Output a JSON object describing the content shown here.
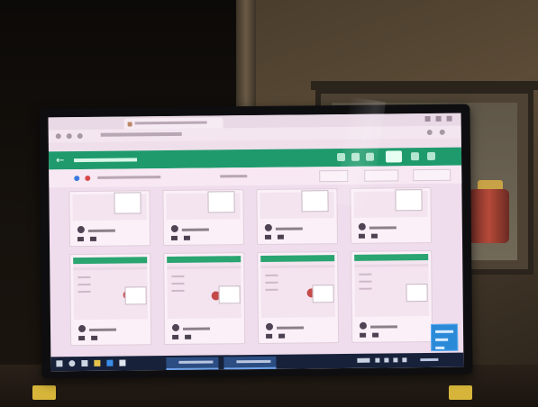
{
  "scene": {
    "colors": {
      "wall": "#5b4b37",
      "monitor_bezel": "#0e0e10",
      "screen": "#efdcec",
      "app_accent": "#1f9a6c",
      "taskbar": "#17213a",
      "notification": "#2b8ad8",
      "feet": "#d6b53a"
    }
  },
  "screen": {
    "app_bar": {
      "back_icon": "←"
    },
    "cards_row1": [
      {
        "id": "c1"
      },
      {
        "id": "c2"
      },
      {
        "id": "c3"
      },
      {
        "id": "c4"
      }
    ],
    "cards_row2": [
      {
        "id": "c5"
      },
      {
        "id": "c6"
      },
      {
        "id": "c7"
      },
      {
        "id": "c8"
      }
    ]
  }
}
